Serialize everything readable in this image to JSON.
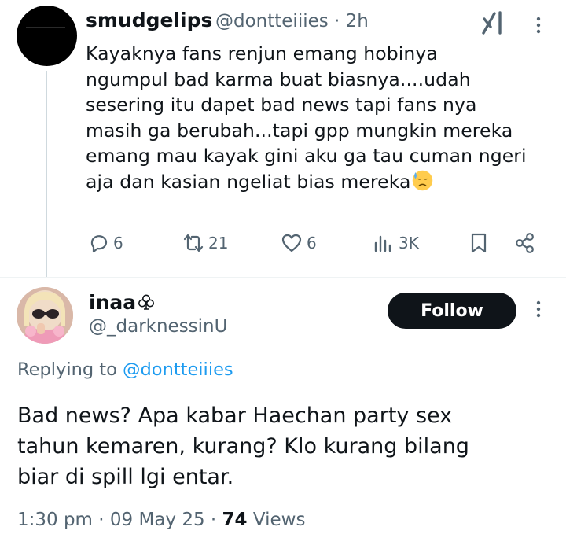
{
  "parent_tweet": {
    "display_name": "smudgelips",
    "handle_time": "@dontteiiies · 2h",
    "body": "Kayaknya fans renjun emang hobinya\nngumpul bad karma buat biasnya....udah\nsesering itu dapet bad news tapi fans nya\nmasih ga berubah...tapi gpp mungkin mereka\nemang mau kayak gini aku ga tau cuman ngeri\naja dan kasian ngeliat bias mereka",
    "emoji": "sad-sweat-face",
    "actions": {
      "replies": "6",
      "reposts": "21",
      "likes": "6",
      "views": "3K"
    }
  },
  "reply_tweet": {
    "display_name": "inaa",
    "name_symbol": "club-icon",
    "handle": "@_darknessinU",
    "follow_label": "Follow",
    "replying_prefix": "Replying to",
    "replying_mention": "@dontteiiies",
    "body": "Bad news? Apa kabar Haechan party sex\ntahun kemaren, kurang? Klo kurang bilang\nbiar di spill lgi entar.",
    "time": "1:30 pm · 09 May 25 · ",
    "views_count": "74",
    "views_label": "Views"
  },
  "colors": {
    "text": "#0f1419",
    "secondary": "#536471",
    "link": "#1d9bf0",
    "divider": "#eff3f4"
  }
}
